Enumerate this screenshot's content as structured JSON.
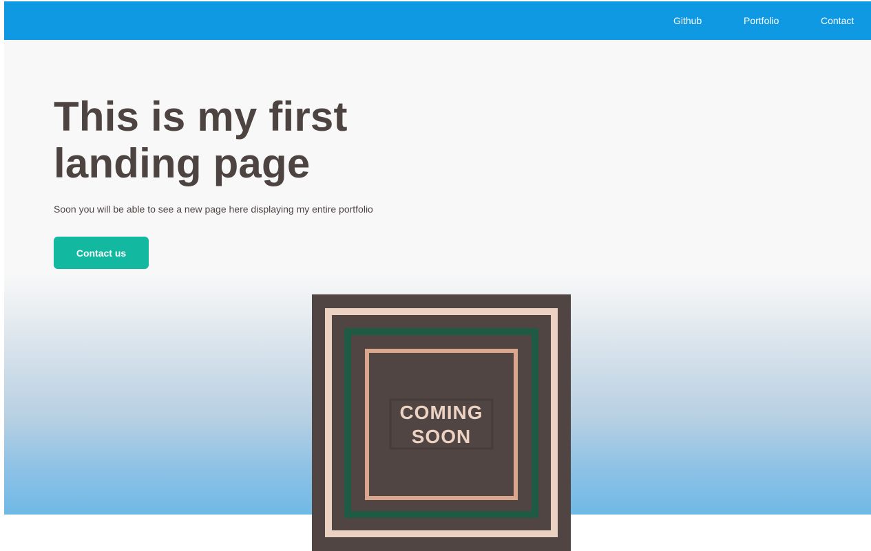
{
  "nav": {
    "items": [
      {
        "label": "Github"
      },
      {
        "label": "Portfolio"
      },
      {
        "label": "Contact"
      }
    ]
  },
  "hero": {
    "title_line_1": "This is my first",
    "title_line_2": "landing page",
    "subtitle": "Soon you will be able to see a new page here displaying my entire portfolio",
    "cta_label": "Contact us"
  },
  "coming_soon": {
    "line_1": "COMING",
    "line_2": "SOON"
  },
  "colors": {
    "nav_bg": "#1099e3",
    "text_dark": "#4d4442",
    "cta_bg": "#12b8a0",
    "art_bg": "#514543",
    "art_frame_outer": "#ecd2c2",
    "art_frame_green": "#1f5a45",
    "art_frame_inner": "#d8a78d",
    "art_text": "#ecd2c2"
  },
  "icons": {
    "illustration": "coming-soon-frame-illustration"
  }
}
